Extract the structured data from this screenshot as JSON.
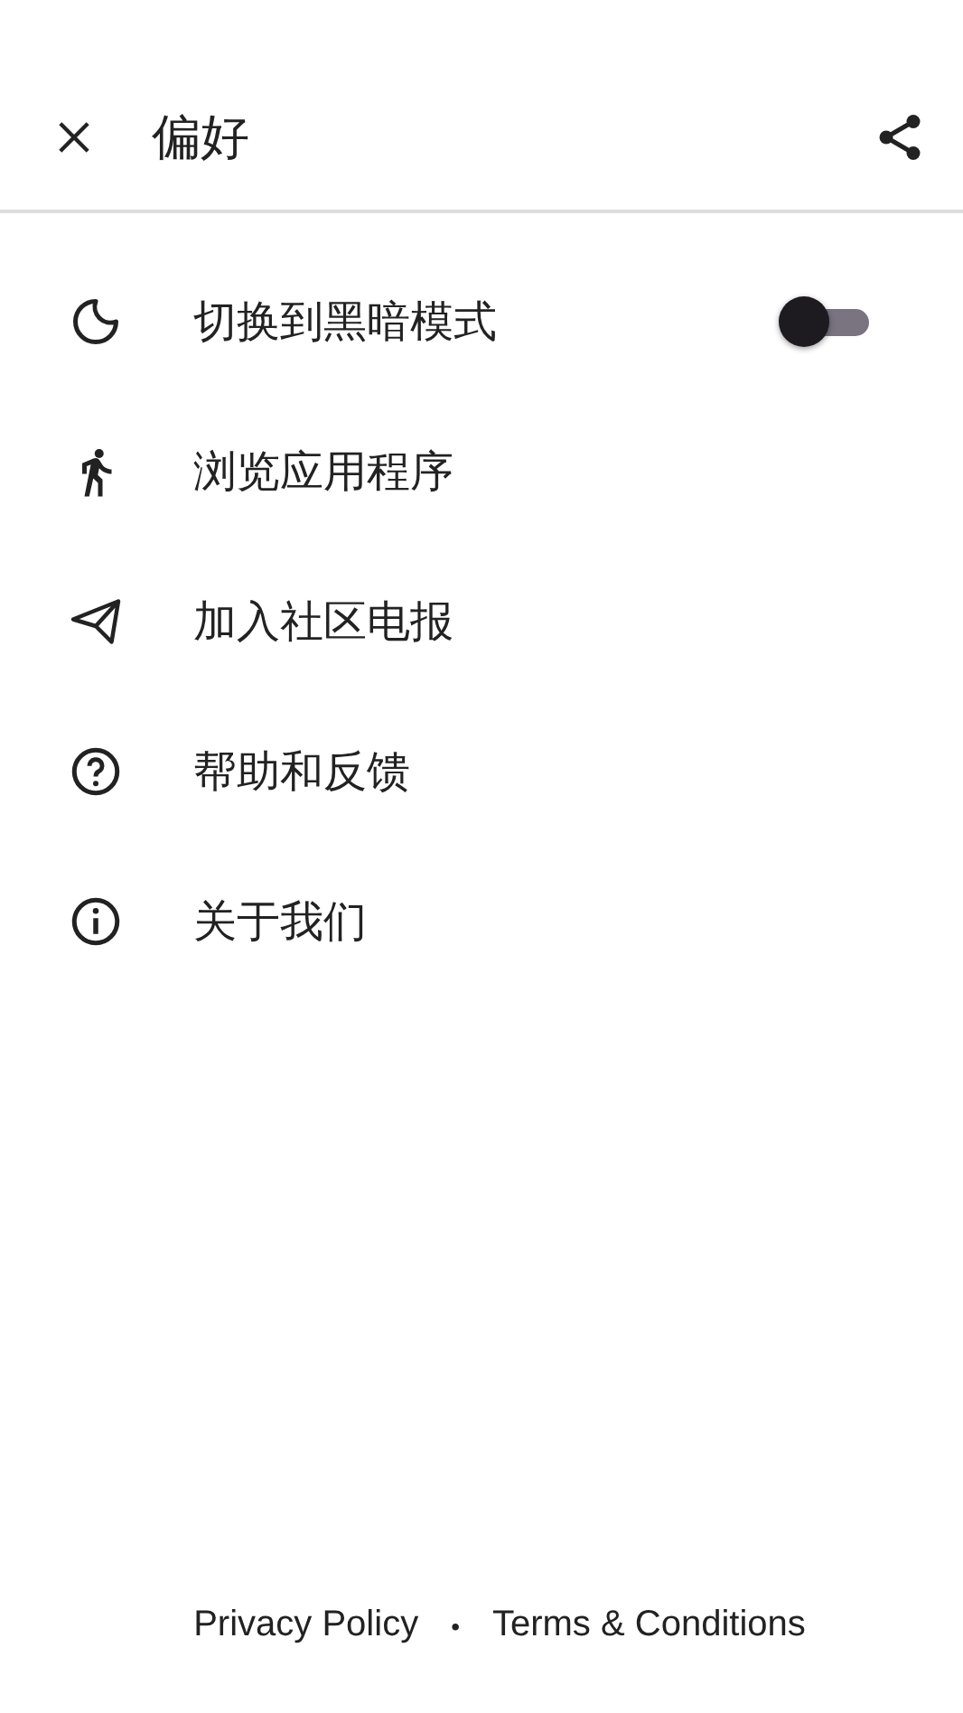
{
  "header": {
    "title": "偏好"
  },
  "items": [
    {
      "kind": "toggle",
      "label": "切换到黑暗模式",
      "on": false
    },
    {
      "kind": "link",
      "label": "浏览应用程序"
    },
    {
      "kind": "link",
      "label": "加入社区电报"
    },
    {
      "kind": "link",
      "label": "帮助和反馈"
    },
    {
      "kind": "link",
      "label": "关于我们"
    }
  ],
  "footer": {
    "links": [
      "Privacy Policy",
      "Terms & Conditions"
    ],
    "separator": "•"
  }
}
